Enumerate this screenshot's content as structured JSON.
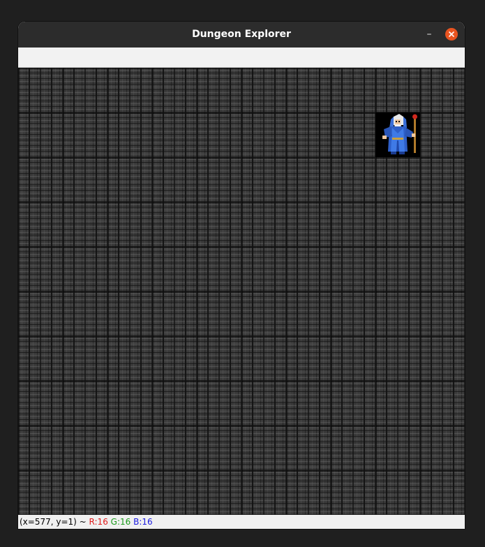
{
  "window": {
    "title": "Dungeon Explorer",
    "minimize_glyph": "–"
  },
  "status": {
    "coords": "(x=577, y=1) ~",
    "r": "R:16",
    "g": "G:16",
    "b": "B:16"
  },
  "colors": {
    "close_button": "#e95420",
    "titlebar": "#2c2c2c",
    "wall": "#3a3a3a",
    "status_r": "#e01b1b",
    "status_g": "#1a9a1a",
    "status_b": "#1a1ae0"
  },
  "scene": {
    "tile_type": "stone-brick-wall",
    "player_sprite": "wizard-icon"
  }
}
